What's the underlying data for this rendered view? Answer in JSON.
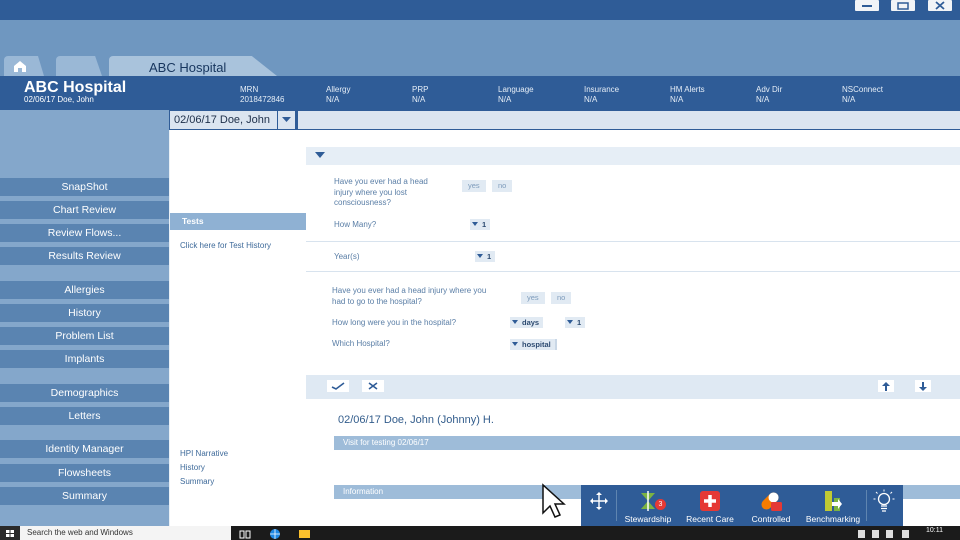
{
  "header": {
    "tabs": [
      {
        "label": "",
        "icon": "home-icon"
      },
      {
        "label": ""
      },
      {
        "label": "ABC Hospital"
      }
    ],
    "hospital_name": "ABC Hospital",
    "hospital_sub": "02/06/17  Doe, John",
    "fields": [
      {
        "label": "MRN",
        "value": "2018472846"
      },
      {
        "label": "Allergy",
        "value": "N/A"
      },
      {
        "label": "PRP",
        "value": "N/A"
      },
      {
        "label": "Language",
        "value": "N/A"
      },
      {
        "label": "Insurance",
        "value": "N/A"
      },
      {
        "label": "HM Alerts",
        "value": "N/A"
      },
      {
        "label": "Adv Dir",
        "value": "N/A"
      },
      {
        "label": "NSConnect",
        "value": "N/A"
      }
    ]
  },
  "nav": {
    "items": [
      "SnapShot",
      "Chart Review",
      "Review Flows...",
      "Results Review",
      "Allergies",
      "History",
      "Problem List",
      "Implants",
      "Demographics",
      "Letters",
      "Identity Manager",
      "Flowsheets",
      "Summary"
    ]
  },
  "patient_select": {
    "value": "02/06/17  Doe, John"
  },
  "mid": {
    "tests_header": "Tests",
    "test_history_link": "Click here for Test History",
    "links": [
      "HPI Narrative",
      "History",
      "Summary"
    ]
  },
  "form": {
    "q1": "Have you ever had a head injury where you lost consciousness?",
    "q1_yes": "yes",
    "q1_no": "no",
    "q2": "How Many?",
    "q2_value": "1",
    "q3": "Year(s)",
    "q3_value": "1",
    "q4": "Have you ever had a head injury where you had to go to the hospital?",
    "q4_yes": "yes",
    "q4_no": "no",
    "q5": "How long were you in the hospital?",
    "q5_unit": "days",
    "q5_value": "1",
    "q6": "Which Hospital?",
    "q6_value": "hospital"
  },
  "note": {
    "name": "02/06/17  Doe, John (Johnny) H.",
    "visit_band": "Visit for testing 02/06/17",
    "info_band": "Information"
  },
  "toolbar": {
    "tools": [
      {
        "label": "",
        "icon": "move-icon"
      },
      {
        "label": "Stewardship",
        "icon": "stewardship-icon",
        "badge": "3"
      },
      {
        "label": "Recent Care",
        "icon": "recent-care-icon"
      },
      {
        "label": "Controlled",
        "icon": "controlled-pill-icon"
      },
      {
        "label": "Benchmarking",
        "icon": "benchmarking-icon"
      },
      {
        "label": "",
        "icon": "lightbulb-icon"
      }
    ]
  },
  "taskbar": {
    "search_placeholder": "Search the web and Windows",
    "clock": "10:11"
  },
  "colors": {
    "title_blue": "#2f5c97",
    "nav_button": "#5a84b1",
    "header_light": "#6f97c0",
    "accent_red": "#e53935",
    "accent_green": "#7cb342",
    "accent_orange": "#f57c00"
  }
}
